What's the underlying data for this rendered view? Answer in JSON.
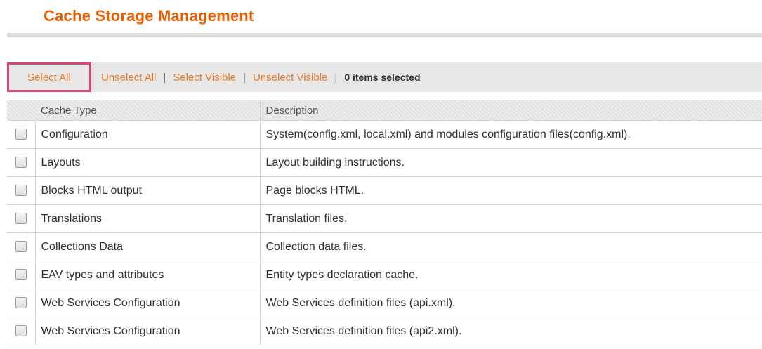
{
  "page": {
    "title": "Cache Storage Management"
  },
  "massaction": {
    "select_all": "Select All",
    "unselect_all": "Unselect All",
    "select_visible": "Select Visible",
    "unselect_visible": "Unselect Visible",
    "separator": "|",
    "items_selected": "0 items selected"
  },
  "grid": {
    "columns": [
      "Cache Type",
      "Description"
    ],
    "rows": [
      {
        "type": "Configuration",
        "description": "System(config.xml, local.xml) and modules configuration files(config.xml).",
        "checked": false
      },
      {
        "type": "Layouts",
        "description": "Layout building instructions.",
        "checked": false
      },
      {
        "type": "Blocks HTML output",
        "description": "Page blocks HTML.",
        "checked": false
      },
      {
        "type": "Translations",
        "description": "Translation files.",
        "checked": false
      },
      {
        "type": "Collections Data",
        "description": "Collection data files.",
        "checked": false
      },
      {
        "type": "EAV types and attributes",
        "description": "Entity types declaration cache.",
        "checked": false
      },
      {
        "type": "Web Services Configuration",
        "description": "Web Services definition files (api.xml).",
        "checked": false
      },
      {
        "type": "Web Services Configuration",
        "description": "Web Services definition files (api2.xml).",
        "checked": false
      }
    ]
  },
  "colors": {
    "title": "#eb5e00",
    "link": "#eb7a2a",
    "highlight": "#d5467c"
  }
}
